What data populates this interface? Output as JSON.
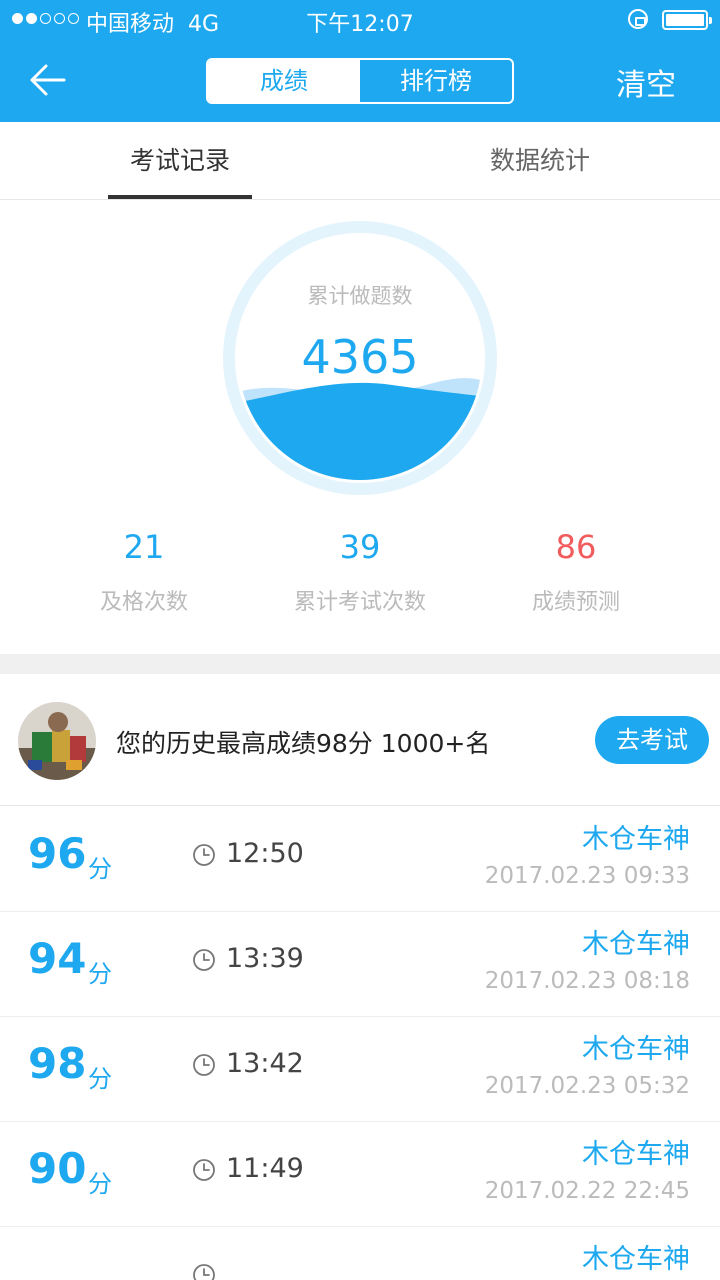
{
  "status_bar": {
    "carrier": "中国移动",
    "network": "4G",
    "time": "下午12:07"
  },
  "nav": {
    "segments": [
      "成绩",
      "排行榜"
    ],
    "selected_segment": "成绩",
    "clear_label": "清空"
  },
  "tabs": {
    "items": [
      "考试记录",
      "数据统计"
    ],
    "selected": "考试记录"
  },
  "gauge": {
    "label": "累计做题数",
    "value": "4365"
  },
  "stats": [
    {
      "value": "21",
      "label": "及格次数"
    },
    {
      "value": "39",
      "label": "累计考试次数"
    },
    {
      "value": "86",
      "label": "成绩预测"
    }
  ],
  "best": {
    "text": "您的历史最高成绩98分 1000+名",
    "button": "去考试"
  },
  "records": [
    {
      "score": "96",
      "unit": "分",
      "duration": "12:50",
      "name": "木仓车神",
      "datetime": "2017.02.23 09:33"
    },
    {
      "score": "94",
      "unit": "分",
      "duration": "13:39",
      "name": "木仓车神",
      "datetime": "2017.02.23 08:18"
    },
    {
      "score": "98",
      "unit": "分",
      "duration": "13:42",
      "name": "木仓车神",
      "datetime": "2017.02.23 05:32"
    },
    {
      "score": "90",
      "unit": "分",
      "duration": "11:49",
      "name": "木仓车神",
      "datetime": "2017.02.22 22:45"
    },
    {
      "score": "",
      "unit": "",
      "duration": "",
      "name": "木仓车神",
      "datetime": ""
    }
  ],
  "colors": {
    "accent": "#1ea8ef",
    "prediction": "#f25c5c",
    "muted_text": "#bbbbbb"
  }
}
